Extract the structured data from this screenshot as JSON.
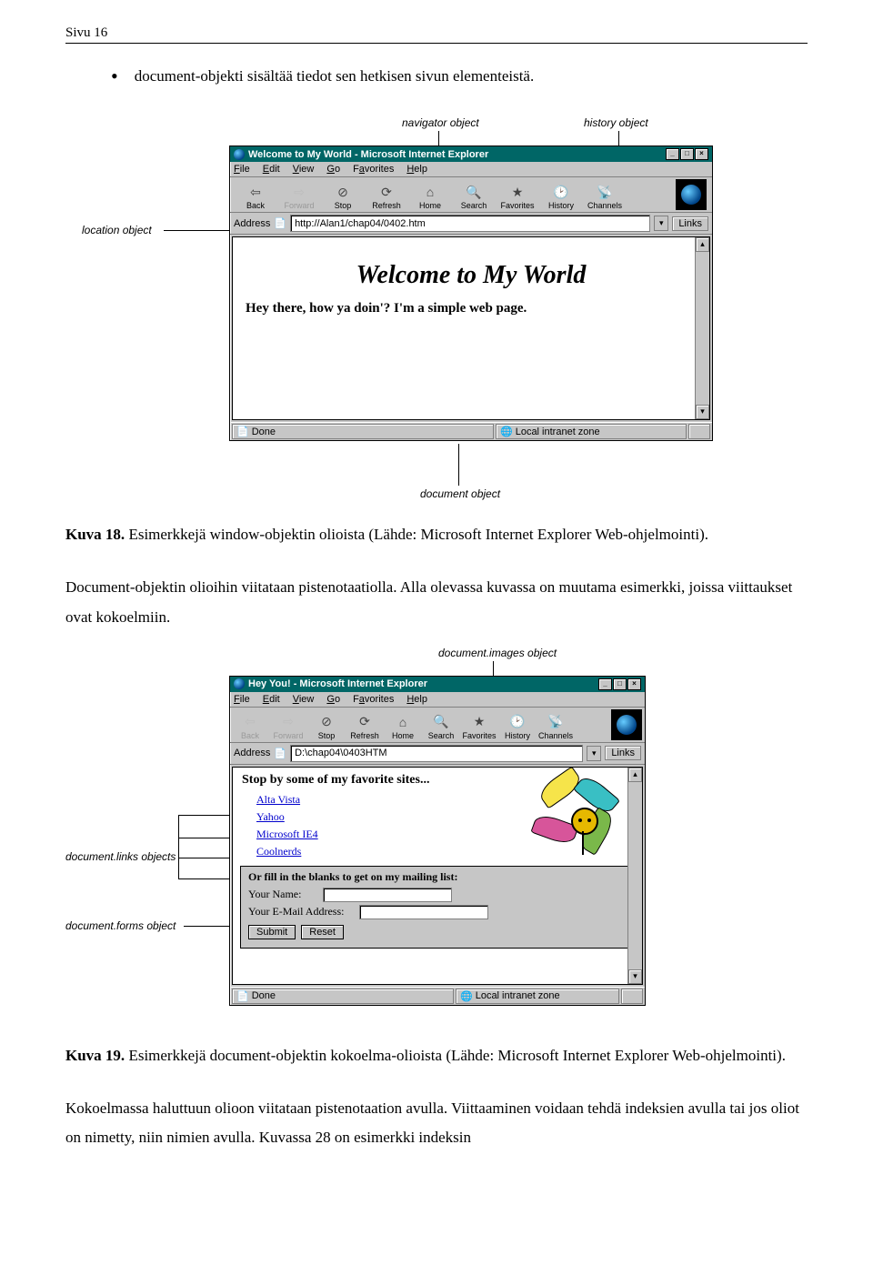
{
  "page_header": "Sivu 16",
  "bullet_text": "document-objekti sisältää tiedot sen hetkisen sivun elementeistä.",
  "caption18_bold": "Kuva 18.",
  "caption18_rest": " Esimerkkejä window-objektin olioista (Lähde: Microsoft Internet Explorer Web-ohjelmointi).",
  "para_mid": "Document-objektin olioihin viitataan pistenotaatiolla. Alla olevassa kuvassa on muutama esimerkki, joissa viittaukset ovat kokoelmiin.",
  "caption19_bold": "Kuva 19.",
  "caption19_rest": " Esimerkkejä document-objektin kokoelma-olioista (Lähde: Microsoft Internet Explorer Web-ohjelmointi).",
  "para_end": "Kokoelmassa haluttuun olioon viitataan pistenotaation avulla. Viittaaminen voidaan tehdä indeksien avulla tai jos oliot on nimetty, niin nimien avulla. Kuvassa 28 on esimerkki indeksin",
  "fig18": {
    "ann_navigator": "navigator object",
    "ann_history": "history object",
    "ann_location": "location object",
    "ann_document": "document object",
    "title": "Welcome to My World - Microsoft Internet Explorer",
    "menu": [
      "File",
      "Edit",
      "View",
      "Go",
      "Favorites",
      "Help"
    ],
    "toolbar": [
      {
        "label": "Back",
        "glyph": "⇦",
        "dim": false
      },
      {
        "label": "Forward",
        "glyph": "⇨",
        "dim": true
      },
      {
        "label": "Stop",
        "glyph": "⊘",
        "dim": false
      },
      {
        "label": "Refresh",
        "glyph": "⟳",
        "dim": false
      },
      {
        "label": "Home",
        "glyph": "⌂",
        "dim": false
      },
      {
        "label": "Search",
        "glyph": "🔍",
        "dim": false
      },
      {
        "label": "Favorites",
        "glyph": "★",
        "dim": false
      },
      {
        "label": "History",
        "glyph": "🕑",
        "dim": false
      },
      {
        "label": "Channels",
        "glyph": "📡",
        "dim": false
      }
    ],
    "addr_label": "Address",
    "addr_value": "http://Alan1/chap04/0402.htm",
    "links_label": "Links",
    "content_h1": "Welcome to My World",
    "content_p": "Hey there, how ya doin'? I'm a simple web page.",
    "status_done": "Done",
    "status_zone": "Local intranet zone"
  },
  "fig19": {
    "ann_images": "document.images object",
    "ann_links": "document.links objects",
    "ann_forms": "document.forms object",
    "title": "Hey You! - Microsoft Internet Explorer",
    "menu": [
      "File",
      "Edit",
      "View",
      "Go",
      "Favorites",
      "Help"
    ],
    "toolbar": [
      {
        "label": "Back",
        "glyph": "⇦",
        "dim": true
      },
      {
        "label": "Forward",
        "glyph": "⇨",
        "dim": true
      },
      {
        "label": "Stop",
        "glyph": "⊘",
        "dim": false
      },
      {
        "label": "Refresh",
        "glyph": "⟳",
        "dim": false
      },
      {
        "label": "Home",
        "glyph": "⌂",
        "dim": false
      },
      {
        "label": "Search",
        "glyph": "🔍",
        "dim": false
      },
      {
        "label": "Favorites",
        "glyph": "★",
        "dim": false
      },
      {
        "label": "History",
        "glyph": "🕑",
        "dim": false
      },
      {
        "label": "Channels",
        "glyph": "📡",
        "dim": false
      }
    ],
    "addr_label": "Address",
    "addr_value": "D:\\chap04\\0403HTM",
    "links_label": "Links",
    "content_h": "Stop by some of my favorite sites...",
    "links": [
      "Alta Vista",
      "Yahoo",
      "Microsoft IE4",
      "Coolnerds"
    ],
    "form_header": "Or fill in the blanks to get on my mailing list:",
    "form_name_label": "Your Name:",
    "form_email_label": "Your E-Mail Address:",
    "btn_submit": "Submit",
    "btn_reset": "Reset",
    "status_done": "Done",
    "status_zone": "Local intranet zone"
  }
}
